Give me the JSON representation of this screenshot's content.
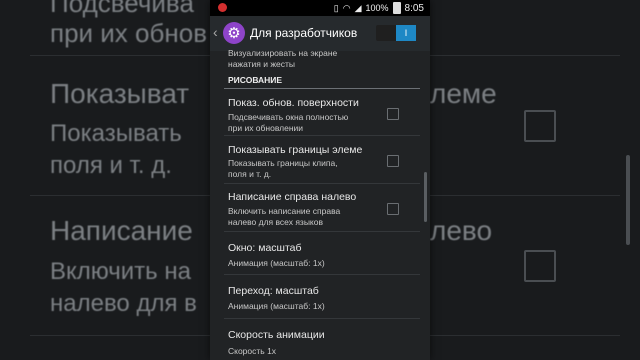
{
  "status_bar": {
    "battery": "100%",
    "time": "8:05"
  },
  "action_bar": {
    "title": "Для разработчиков",
    "toggle_label": "I"
  },
  "top_partial": {
    "subtitle_line1": "Визуализировать на экране",
    "subtitle_line2": "нажатия и жесты"
  },
  "section": {
    "title": "РИСОВАНИЕ"
  },
  "settings": [
    {
      "title": "Показ. обнов. поверхности",
      "subtitle_line1": "Подсвечивать окна полностью",
      "subtitle_line2": "при их обновлении",
      "checked": false
    },
    {
      "title": "Показывать границы элеме",
      "subtitle_line1": "Показывать границы клипа,",
      "subtitle_line2": "поля и т. д.",
      "checked": false
    },
    {
      "title": "Написание справа налево",
      "subtitle_line1": "Включить написание справа",
      "subtitle_line2": "налево для всех языков",
      "checked": false
    },
    {
      "title": "Окно: масштаб",
      "subtitle_line1": "Анимация (масштаб: 1x)"
    },
    {
      "title": "Переход: масштаб",
      "subtitle_line1": "Анимация (масштаб: 1x)"
    },
    {
      "title": "Скорость анимации",
      "subtitle_line1": "Скорость 1x"
    }
  ],
  "background": {
    "partial_top_left": "Подсвечива",
    "partial_top_left2": "при их обнов",
    "row1_title": "Показыват",
    "row1_title_tail": "леме",
    "row1_sub1": "Показывать",
    "row1_sub2": "поля и т. д.",
    "row2_title": "Написание",
    "row2_title_tail": "лево",
    "row2_sub1": "Включить на",
    "row2_sub2": "налево для в"
  },
  "colors": {
    "accent": "#1e88c5",
    "app_icon": "#8e44c9",
    "record": "#d32f2f"
  }
}
